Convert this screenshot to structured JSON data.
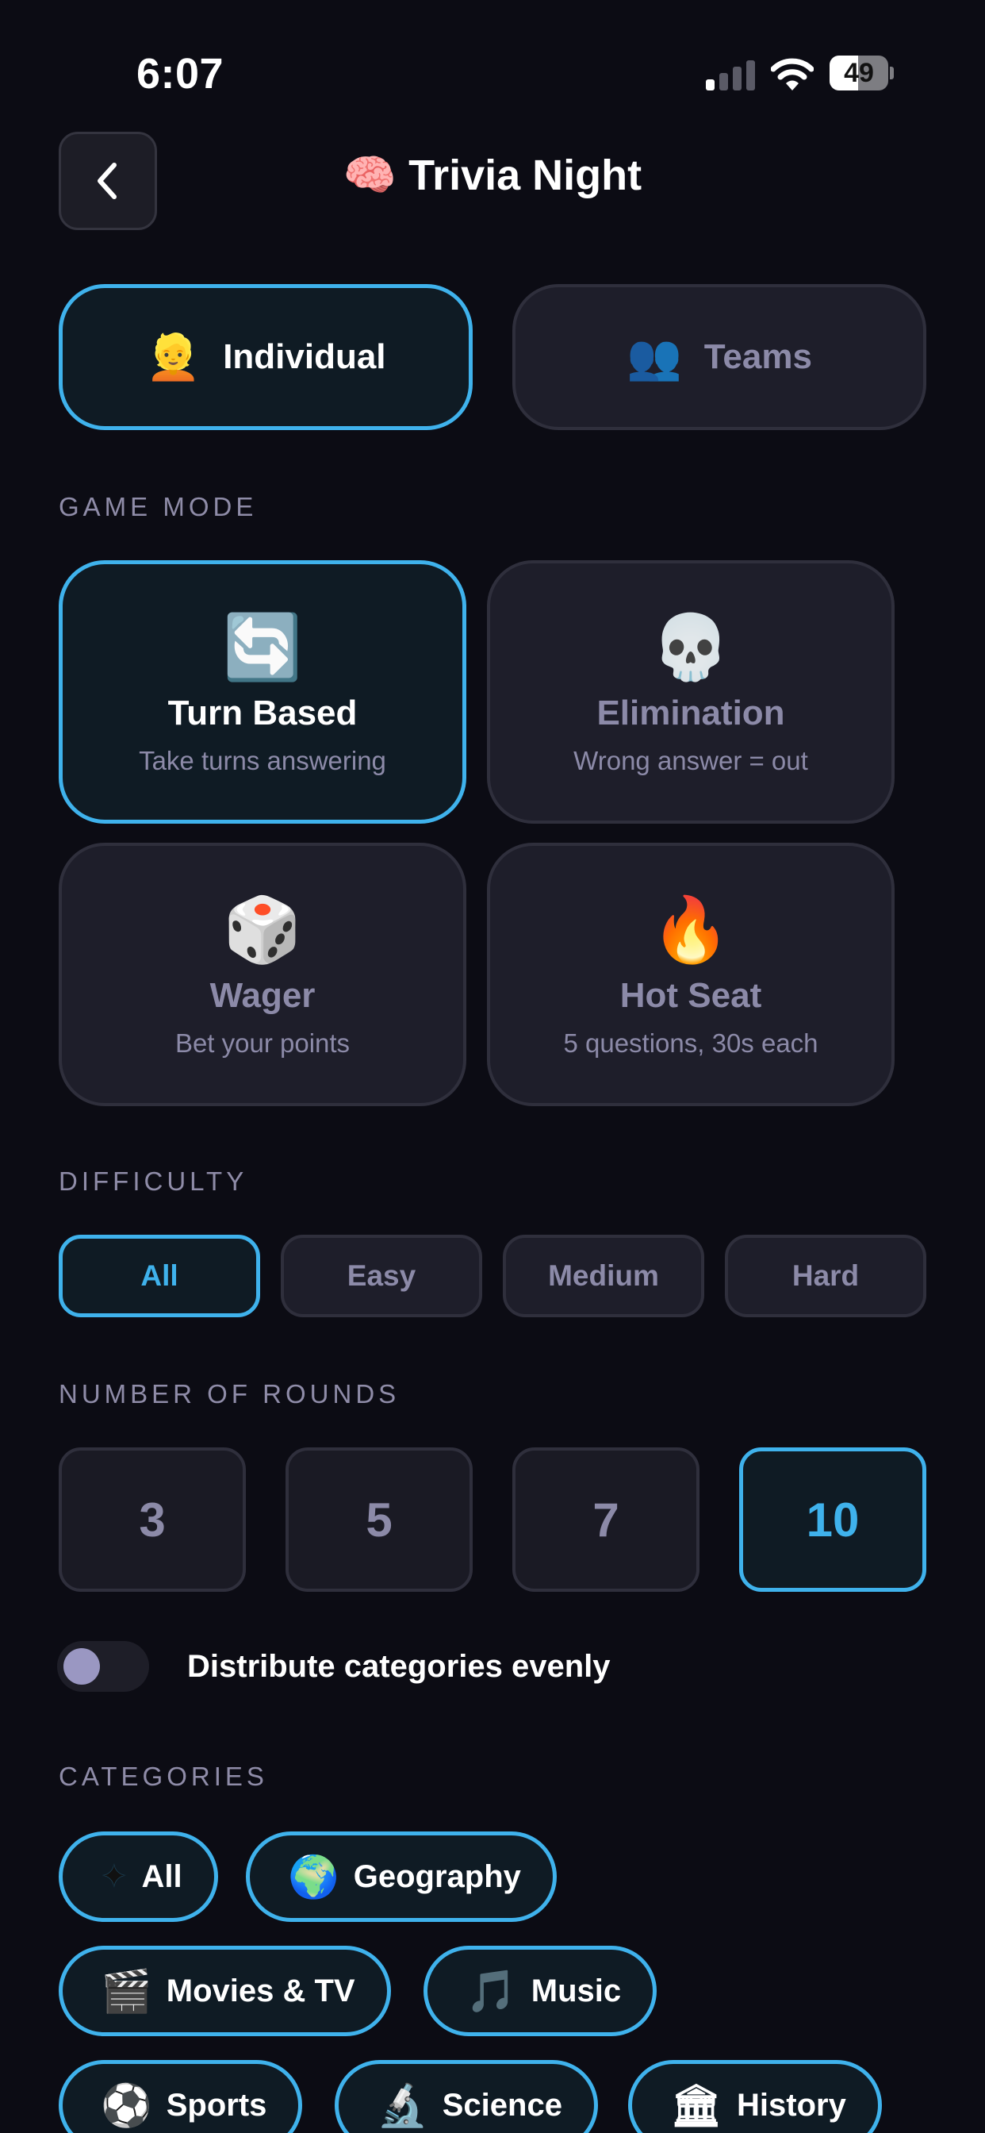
{
  "status_bar": {
    "time": "6:07",
    "battery": "49",
    "battery_level": 0.49
  },
  "header": {
    "title": "🧠 Trivia Night",
    "back_icon": "chevron-left-icon"
  },
  "player_mode": {
    "options": [
      {
        "emoji": "👱",
        "label": "Individual",
        "selected": true
      },
      {
        "emoji": "👥",
        "label": "Teams",
        "selected": false
      }
    ]
  },
  "game_mode": {
    "label": "GAME MODE",
    "options": [
      {
        "emoji": "🔄",
        "name": "Turn Based",
        "desc": "Take turns answering",
        "selected": true
      },
      {
        "emoji": "💀",
        "name": "Elimination",
        "desc": "Wrong answer = out",
        "selected": false
      },
      {
        "emoji": "🎲",
        "name": "Wager",
        "desc": "Bet your points",
        "selected": false
      },
      {
        "emoji": "🔥",
        "name": "Hot Seat",
        "desc": "5 questions, 30s each",
        "selected": false
      }
    ]
  },
  "difficulty": {
    "label": "DIFFICULTY",
    "options": [
      "All",
      "Easy",
      "Medium",
      "Hard"
    ],
    "selected": "All"
  },
  "rounds": {
    "label": "NUMBER OF ROUNDS",
    "options": [
      "3",
      "5",
      "7",
      "10"
    ],
    "selected": "10"
  },
  "distribute": {
    "label": "Distribute categories evenly",
    "enabled": false
  },
  "categories": {
    "label": "CATEGORIES",
    "items": [
      {
        "emoji": "✦",
        "label": "All"
      },
      {
        "emoji": "🌍",
        "label": "Geography"
      },
      {
        "emoji": "🎬",
        "label": "Movies & TV"
      },
      {
        "emoji": "🎵",
        "label": "Music"
      },
      {
        "emoji": "⚽",
        "label": "Sports"
      },
      {
        "emoji": "🔬",
        "label": "Science"
      },
      {
        "emoji": "🏛",
        "label": "History"
      }
    ]
  },
  "colors": {
    "accent": "#3fb2ec",
    "background": "#0c0c14",
    "card": "#1e1e2a",
    "muted": "#8c8aa8"
  }
}
